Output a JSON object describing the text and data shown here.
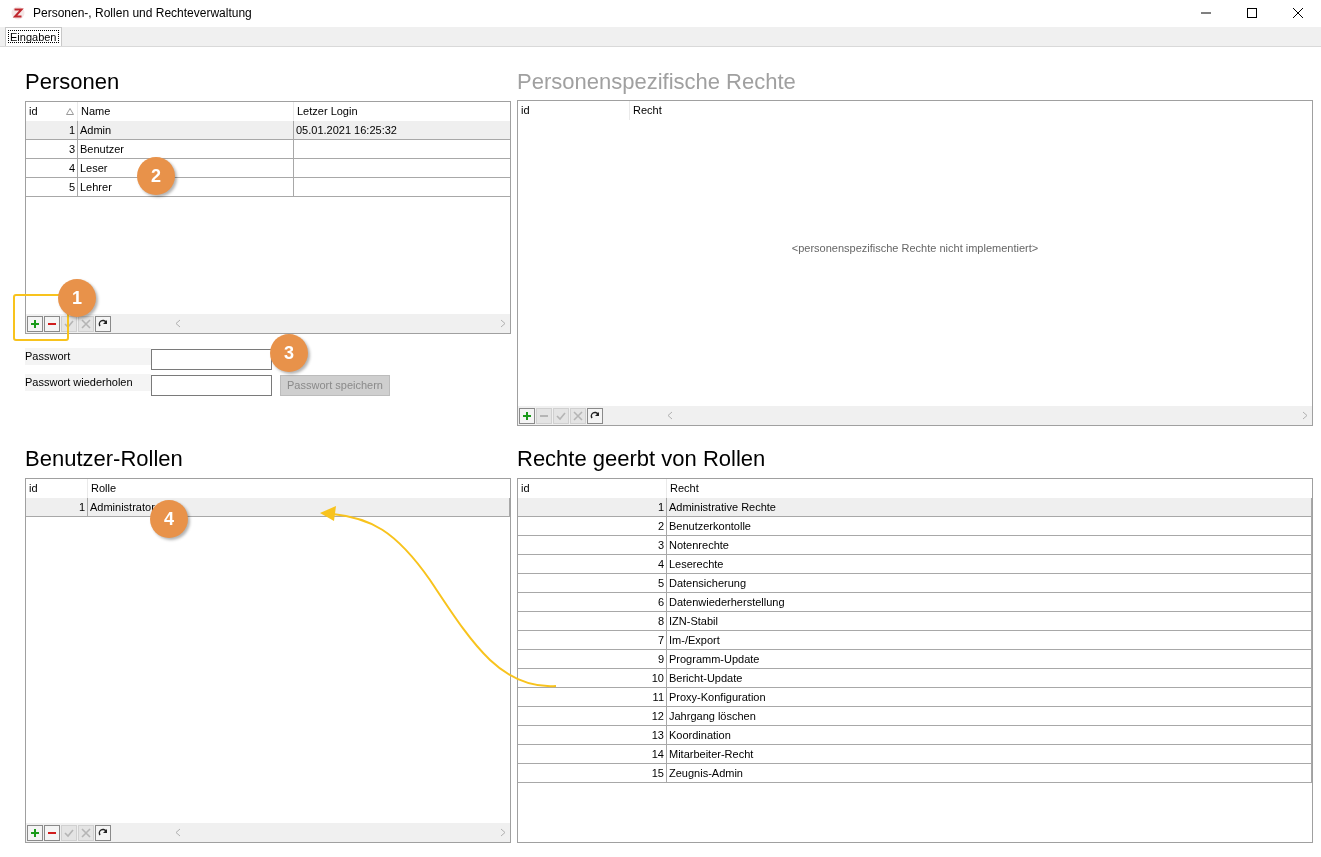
{
  "window": {
    "title": "Personen-, Rollen und Rechteverwaltung"
  },
  "tabs": [
    {
      "label": "Eingaben",
      "selected": true
    }
  ],
  "personen": {
    "heading": "Personen",
    "columns": [
      {
        "label": "id",
        "sorted": true
      },
      {
        "label": "Name",
        "sorted": false
      },
      {
        "label": "Letzer Login",
        "sorted": false
      }
    ],
    "rows": [
      {
        "id": "1",
        "name": "Admin",
        "login": "05.01.2021 16:25:32",
        "selected": true
      },
      {
        "id": "3",
        "name": "Benutzer",
        "selected": false
      },
      {
        "id": "4",
        "name": "Leser",
        "selected": false
      },
      {
        "id": "5",
        "name": "Lehrer",
        "selected": false
      }
    ],
    "toolbar": [
      {
        "kind": "add",
        "disabled": false
      },
      {
        "kind": "remove",
        "disabled": false
      },
      {
        "kind": "confirm",
        "disabled": true
      },
      {
        "kind": "cancel",
        "disabled": true
      },
      {
        "kind": "refresh",
        "disabled": false
      }
    ]
  },
  "password": {
    "fields": [
      {
        "label": "Passwort"
      },
      {
        "label": "Passwort wiederholen"
      }
    ],
    "button": {
      "label": "Passwort speichern",
      "disabled": true
    }
  },
  "personenspezifische_rechte": {
    "heading": "Personenspezifische Rechte",
    "heading_disabled": true,
    "columns": [
      "id",
      "Recht"
    ],
    "empty_message": "<personenspezifische Rechte nicht implementiert>",
    "toolbar": [
      {
        "kind": "add",
        "disabled": false
      },
      {
        "kind": "remove",
        "disabled": true
      },
      {
        "kind": "confirm",
        "disabled": true
      },
      {
        "kind": "cancel",
        "disabled": true
      },
      {
        "kind": "refresh",
        "disabled": false
      }
    ]
  },
  "benutzer_rollen": {
    "heading": "Benutzer-Rollen",
    "columns": [
      "id",
      "Rolle"
    ],
    "rows": [
      {
        "id": "1",
        "name": "Administrator",
        "selected": true
      }
    ],
    "toolbar": [
      {
        "kind": "add",
        "disabled": false
      },
      {
        "kind": "remove",
        "disabled": false
      },
      {
        "kind": "confirm",
        "disabled": true
      },
      {
        "kind": "cancel",
        "disabled": true
      },
      {
        "kind": "refresh",
        "disabled": false
      }
    ]
  },
  "rechte_geerbt": {
    "heading": "Rechte geerbt von Rollen",
    "columns": [
      "id",
      "Recht"
    ],
    "rows": [
      {
        "id": "1",
        "name": "Administrative Rechte",
        "selected": true
      },
      {
        "id": "2",
        "name": "Benutzerkontolle",
        "selected": false
      },
      {
        "id": "3",
        "name": "Notenrechte",
        "selected": false
      },
      {
        "id": "4",
        "name": "Leserechte",
        "selected": false
      },
      {
        "id": "5",
        "name": "Datensicherung",
        "selected": false
      },
      {
        "id": "6",
        "name": "Datenwiederherstellung",
        "selected": false
      },
      {
        "id": "8",
        "name": "IZN-Stabil",
        "selected": false
      },
      {
        "id": "7",
        "name": "Im-/Export",
        "selected": false
      },
      {
        "id": "9",
        "name": "Programm-Update",
        "selected": false
      },
      {
        "id": "10",
        "name": "Bericht-Update",
        "selected": false
      },
      {
        "id": "11",
        "name": "Proxy-Konfiguration",
        "selected": false
      },
      {
        "id": "12",
        "name": "Jahrgang löschen",
        "selected": false
      },
      {
        "id": "13",
        "name": "Koordination",
        "selected": false
      },
      {
        "id": "14",
        "name": "Mitarbeiter-Recht",
        "selected": false
      },
      {
        "id": "15",
        "name": "Zeugnis-Admin",
        "selected": false
      }
    ]
  },
  "annotations": {
    "badges": [
      "1",
      "2",
      "3",
      "4"
    ]
  }
}
